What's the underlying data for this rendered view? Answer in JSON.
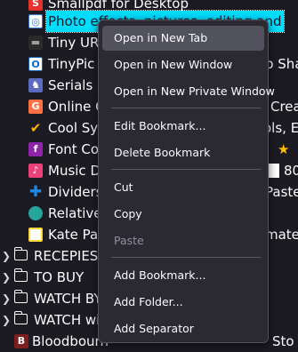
{
  "bookmarks": [
    {
      "label": "Smallpdf for Desktop",
      "icon": "smallpdf-icon",
      "color": "#e5322d"
    },
    {
      "label": "Photo effects, pictures, editing and",
      "icon": "photo-effects-icon",
      "color": "#3a7bd5",
      "selected": true
    },
    {
      "label": "Tiny URL",
      "icon": "tinyurl-icon",
      "color": "#2a2a2a"
    },
    {
      "label": "TinyPic -",
      "tail": "p Sha",
      "icon": "tinypic-icon",
      "color": "#1565c0"
    },
    {
      "label": "Serials &",
      "icon": "serials-icon",
      "color": "#5c6bc0"
    },
    {
      "label": "Online G",
      "tail": "Crea",
      "icon": "online-g-icon",
      "color": "#ff7043"
    },
    {
      "label": "Cool Sym",
      "tail": "ols, E",
      "icon": "checkmark-icon",
      "color": "#43a047"
    },
    {
      "label": "Font Cop",
      "tail": "★",
      "icon": "font-copy-icon",
      "color": "#8e24aa"
    },
    {
      "label": "Music D",
      "tail": "80",
      "icon": "music-icon",
      "color": "#ec407a"
    },
    {
      "label": "Dividers",
      "tail": "Paste",
      "icon": "plus-icon",
      "color": "#1e88e5"
    },
    {
      "label": "Relative",
      "icon": "globe-icon",
      "color": "#26a69a"
    },
    {
      "label": "Kate Pair",
      "tail": "mated",
      "icon": "document-icon",
      "color": "#fdd835"
    }
  ],
  "folders": [
    {
      "label": "RECEPIES"
    },
    {
      "label": "TO BUY"
    },
    {
      "label": "WATCH BY"
    },
    {
      "label": "WATCH wi"
    }
  ],
  "last_row": {
    "label": "Bloodbourn",
    "tail": "Sto",
    "icon": "bloodborne-icon",
    "color": "#7b1f1f"
  },
  "context_menu": {
    "open_new_tab": "Open in New Tab",
    "open_new_window": "Open in New Window",
    "open_private_window": "Open in New Private Window",
    "edit_bookmark": "Edit Bookmark...",
    "delete_bookmark": "Delete Bookmark",
    "cut": "Cut",
    "copy": "Copy",
    "paste": "Paste",
    "add_bookmark": "Add Bookmark...",
    "add_folder": "Add Folder...",
    "add_separator": "Add Separator"
  },
  "colors": {
    "background": "#1c1b22",
    "menu_background": "#2b2a33",
    "selection": "#00ddff",
    "hover": "#52525e"
  }
}
